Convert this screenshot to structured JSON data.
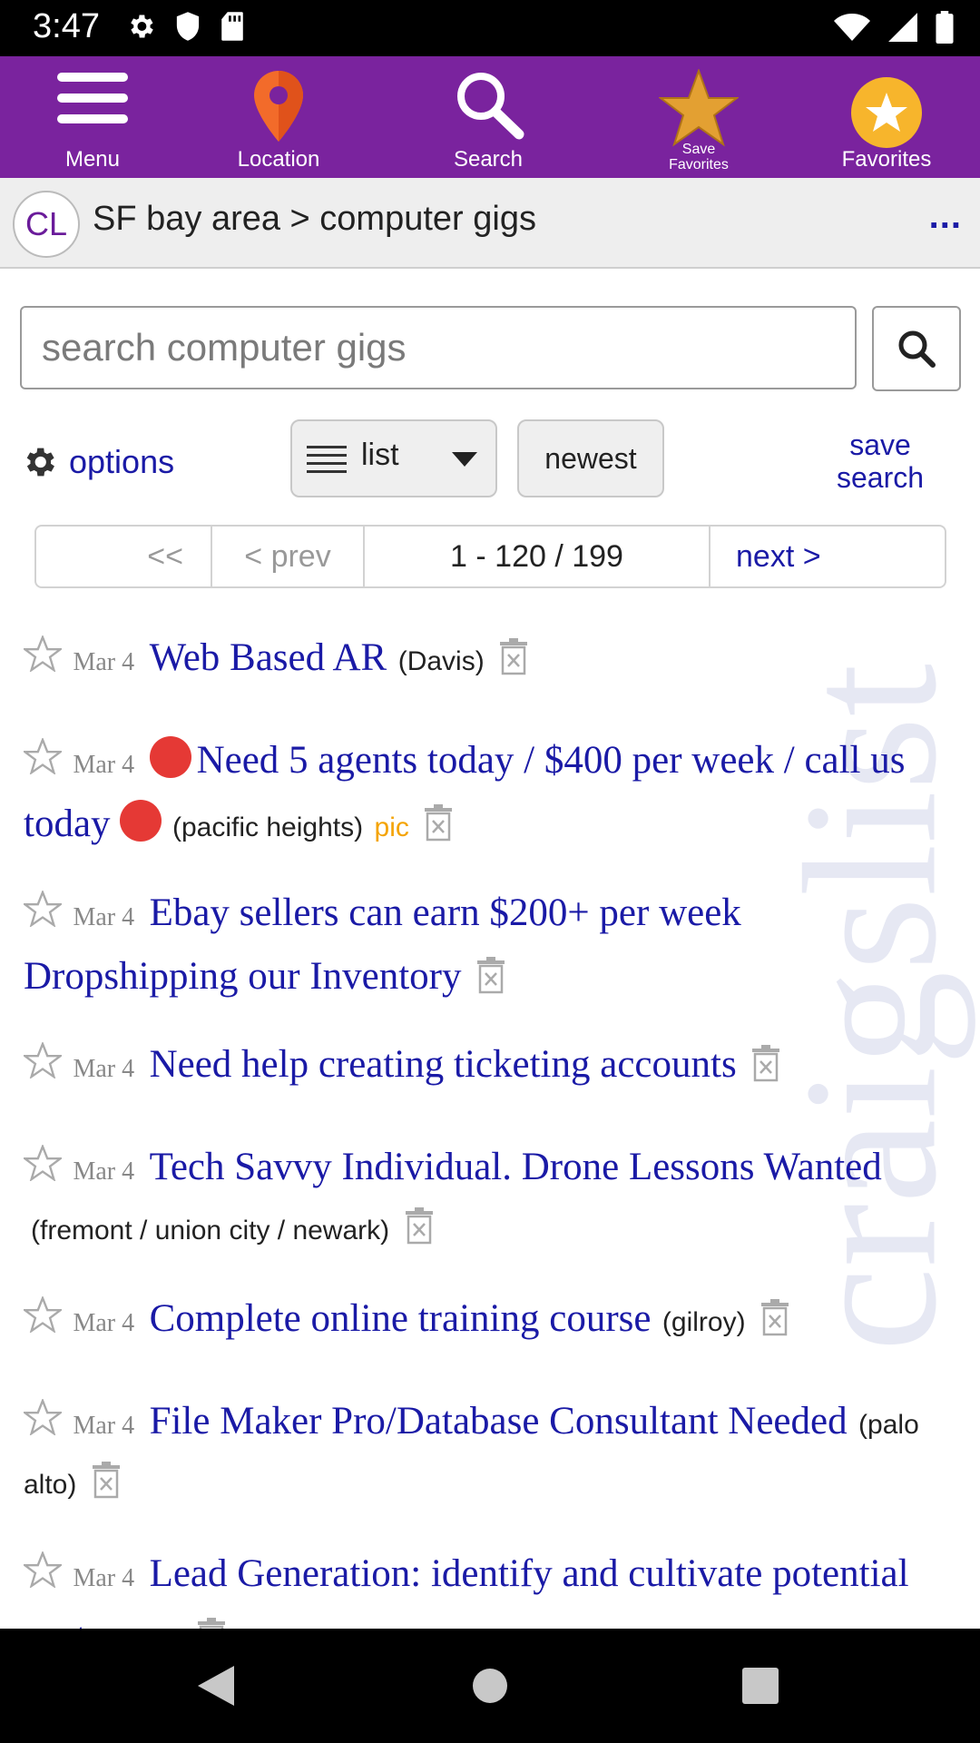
{
  "status_bar": {
    "time": "3:47",
    "left_icons": [
      "gear-icon",
      "shield-icon",
      "sd-card-icon"
    ],
    "right_icons": [
      "wifi-icon",
      "cell-signal-icon",
      "battery-icon"
    ]
  },
  "toolbar": {
    "menu_label": "Menu",
    "location_label": "Location",
    "search_label": "Search",
    "save_favorites_label": "Save\nFavorites",
    "favorites_label": "Favorites",
    "bg_color": "#7a239e",
    "location_color": "#f26b2a",
    "star_color": "#e3a032",
    "favorites_circle_color": "#f7b52c"
  },
  "breadcrumb": {
    "logo_text": "CL",
    "text": "SF bay area > computer gigs",
    "more_label": "..."
  },
  "watermark": "craigslist",
  "search": {
    "placeholder": "search computer gigs"
  },
  "controls": {
    "options_label": "options",
    "view_label": "list",
    "sort_label": "newest",
    "save_search_label": "save search"
  },
  "pager": {
    "first": "<<",
    "prev": "< prev",
    "range": "1 - 120 / 199",
    "next": "next >"
  },
  "results": [
    {
      "date": "Mar 4",
      "title": "Web Based AR",
      "location": "(Davis)",
      "pic": "",
      "red_dots": false
    },
    {
      "date": "Mar 4",
      "title": "Need 5 agents today / $400 per week / call us today",
      "location": "(pacific heights)",
      "pic": "pic",
      "red_dots": true
    },
    {
      "date": "Mar 4",
      "title": "Ebay sellers can earn $200+ per week Dropshipping our Inventory",
      "location": "",
      "pic": "",
      "red_dots": false
    },
    {
      "date": "Mar 4",
      "title": "Need help creating ticketing accounts",
      "location": "",
      "pic": "",
      "red_dots": false
    },
    {
      "date": "Mar 4",
      "title": "Tech Savvy Individual. Drone Lessons Wanted",
      "location": "(fremont / union city / newark)",
      "pic": "",
      "red_dots": false
    },
    {
      "date": "Mar 4",
      "title": "Complete online training course",
      "location": "(gilroy)",
      "pic": "",
      "red_dots": false
    },
    {
      "date": "Mar 4",
      "title": "File Maker Pro/Database Consultant Needed",
      "location": "(palo alto)",
      "pic": "",
      "red_dots": false
    },
    {
      "date": "Mar 4",
      "title": "Lead Generation: identify and cultivate potential customers",
      "location": "",
      "pic": "",
      "red_dots": false
    }
  ],
  "nav_bar": {
    "back": "back-triangle-icon",
    "home": "home-circle-icon",
    "recents": "recents-square-icon"
  }
}
